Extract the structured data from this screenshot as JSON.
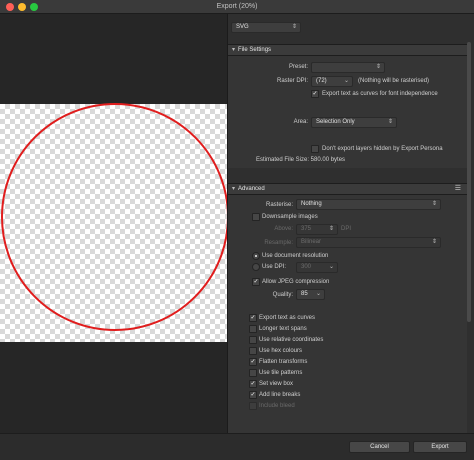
{
  "window": {
    "title": "Export (20%)"
  },
  "format": {
    "value": "SVG"
  },
  "file_settings": {
    "header": "File Settings",
    "preset_label": "Preset:",
    "preset_value": "",
    "raster_dpi_label": "Raster DPI:",
    "raster_dpi_value": "(72)",
    "raster_dpi_note": "(Nothing will be rasterised)",
    "export_text_curves_label": "Export text as curves for font independence",
    "area_label": "Area:",
    "area_value": "Selection Only",
    "dont_export_hidden_label": "Don't export layers hidden by Export Persona",
    "estimated_size_label": "Estimated File Size: 580.00 bytes"
  },
  "advanced": {
    "header": "Advanced",
    "rasterise_label": "Rasterise:",
    "rasterise_value": "Nothing",
    "downsample_label": "Downsample images",
    "above_label": "Above:",
    "above_value": "375",
    "above_unit": "DPI",
    "resample_label": "Resample:",
    "resample_value": "Bilinear",
    "use_doc_res_label": "Use document resolution",
    "use_dpi_label": "Use DPI:",
    "use_dpi_value": "300",
    "allow_jpeg_label": "Allow JPEG compression",
    "quality_label": "Quality:",
    "quality_value": "85",
    "options": [
      {
        "label": "Export text as curves",
        "checked": true,
        "disabled": false
      },
      {
        "label": "Longer text spans",
        "checked": false,
        "disabled": false
      },
      {
        "label": "Use relative coordinates",
        "checked": false,
        "disabled": false
      },
      {
        "label": "Use hex colours",
        "checked": false,
        "disabled": false
      },
      {
        "label": "Flatten transforms",
        "checked": true,
        "disabled": false
      },
      {
        "label": "Use tile patterns",
        "checked": false,
        "disabled": false
      },
      {
        "label": "Set view box",
        "checked": true,
        "disabled": false
      },
      {
        "label": "Add line breaks",
        "checked": true,
        "disabled": false
      },
      {
        "label": "Include bleed",
        "checked": false,
        "disabled": true
      }
    ]
  },
  "footer": {
    "cancel_label": "Cancel",
    "export_label": "Export"
  },
  "colors": {
    "accent_red": "#e01d1d",
    "panel_bg": "#2f2f2f"
  }
}
